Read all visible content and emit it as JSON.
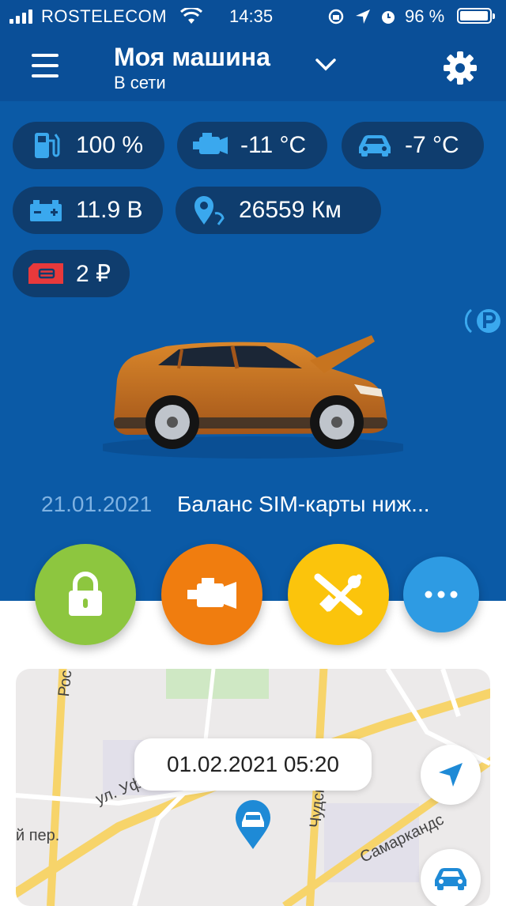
{
  "status_bar": {
    "carrier": "ROSTELECOM",
    "time": "14:35",
    "battery_percent_text": "96 %",
    "battery_level": 0.96
  },
  "header": {
    "title": "Моя машина",
    "subtitle": "В сети"
  },
  "stats": {
    "fuel": "100 %",
    "engine_temp": "-11 °C",
    "cabin_temp": "-7 °C",
    "battery": "11.9 В",
    "mileage": "26559 Км",
    "sim_balance": "2 ₽"
  },
  "notice": {
    "date": "21.01.2021",
    "text": "Баланс SIM-карты ниж..."
  },
  "actions": [
    {
      "name": "lock",
      "color": "#8dc63f"
    },
    {
      "name": "engine",
      "color": "#f07d0f"
    },
    {
      "name": "service",
      "color": "#fbc40c"
    },
    {
      "name": "more",
      "color": "#2e9be3"
    }
  ],
  "map": {
    "timestamp": "01.02.2021 05:20",
    "labels": {
      "street_ufa": "ул. Уфимское шоссе",
      "street_chud": "Чудская",
      "street_sam": "Самаркандс",
      "lane": "й пер.",
      "ros": "Рос"
    }
  },
  "colors": {
    "panel": "#0b5aa6",
    "panel_dark": "#0a4f98",
    "chip": "#0f3d6e",
    "icon": "#3aa8ee",
    "sim_icon": "#e8393b"
  }
}
